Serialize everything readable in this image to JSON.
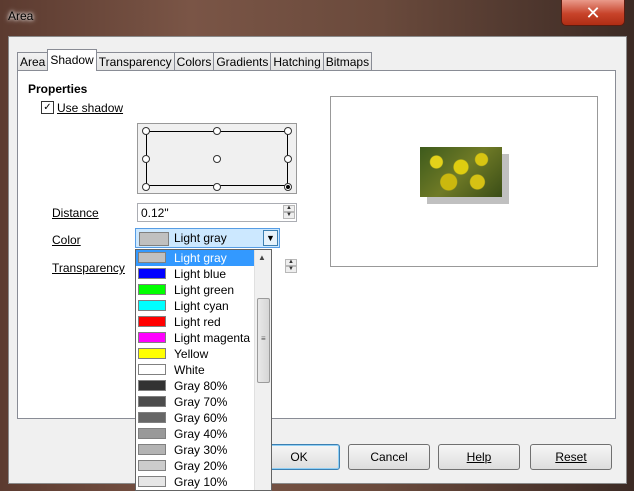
{
  "window": {
    "title": "Area",
    "close_glyph": "✕"
  },
  "tabs": [
    {
      "label": "Area",
      "active": false
    },
    {
      "label": "Shadow",
      "active": true
    },
    {
      "label": "Transparency",
      "active": false
    },
    {
      "label": "Colors",
      "active": false
    },
    {
      "label": "Gradients",
      "active": false
    },
    {
      "label": "Hatching",
      "active": false
    },
    {
      "label": "Bitmaps",
      "active": false
    }
  ],
  "properties": {
    "title": "Properties",
    "use_shadow_label": "Use shadow",
    "use_shadow_checked": true,
    "distance_label": "Distance",
    "distance_value": "0.12\"",
    "color_label": "Color",
    "color_value": "Light gray",
    "transparency_label": "Transparency",
    "position_selected": "bottom-right"
  },
  "color_options": [
    {
      "label": "Light gray",
      "color": "#c0c0c0",
      "selected": true
    },
    {
      "label": "Light blue",
      "color": "#0000ff"
    },
    {
      "label": "Light green",
      "color": "#00ff00"
    },
    {
      "label": "Light cyan",
      "color": "#00ffff"
    },
    {
      "label": "Light red",
      "color": "#ff0000"
    },
    {
      "label": "Light magenta",
      "color": "#ff00ff"
    },
    {
      "label": "Yellow",
      "color": "#ffff00"
    },
    {
      "label": "White",
      "color": "#ffffff"
    },
    {
      "label": "Gray 80%",
      "color": "#333333"
    },
    {
      "label": "Gray 70%",
      "color": "#4c4c4c"
    },
    {
      "label": "Gray 60%",
      "color": "#666666"
    },
    {
      "label": "Gray 40%",
      "color": "#999999"
    },
    {
      "label": "Gray 30%",
      "color": "#b3b3b3"
    },
    {
      "label": "Gray 20%",
      "color": "#cccccc"
    },
    {
      "label": "Gray 10%",
      "color": "#e6e6e6"
    }
  ],
  "buttons": {
    "ok": "OK",
    "cancel": "Cancel",
    "help": "Help",
    "reset": "Reset"
  }
}
